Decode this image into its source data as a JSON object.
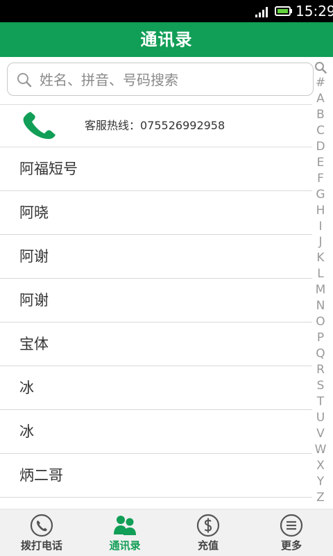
{
  "status_bar": {
    "time": "15:29"
  },
  "header": {
    "title": "通讯录"
  },
  "search": {
    "placeholder": "姓名、拼音、号码搜索"
  },
  "hotline": {
    "label": "客服热线：075526992958"
  },
  "contacts": [
    "阿福短号",
    "阿晓",
    "阿谢",
    "阿谢",
    "宝体",
    "冰",
    "冰",
    "炳二哥"
  ],
  "index_bar": [
    "#",
    "A",
    "B",
    "C",
    "D",
    "E",
    "F",
    "G",
    "H",
    "I",
    "J",
    "K",
    "L",
    "M",
    "N",
    "O",
    "P",
    "Q",
    "R",
    "S",
    "T",
    "U",
    "V",
    "W",
    "X",
    "Y",
    "Z"
  ],
  "bottom_nav": {
    "items": [
      {
        "label": "拨打电话",
        "icon": "phone-circle-icon"
      },
      {
        "label": "通讯录",
        "icon": "contacts-icon",
        "active": true
      },
      {
        "label": "充值",
        "icon": "dollar-icon"
      },
      {
        "label": "更多",
        "icon": "menu-icon"
      }
    ]
  },
  "colors": {
    "brand_green": "#119e56",
    "text": "#333333",
    "index_gray": "#999999"
  }
}
